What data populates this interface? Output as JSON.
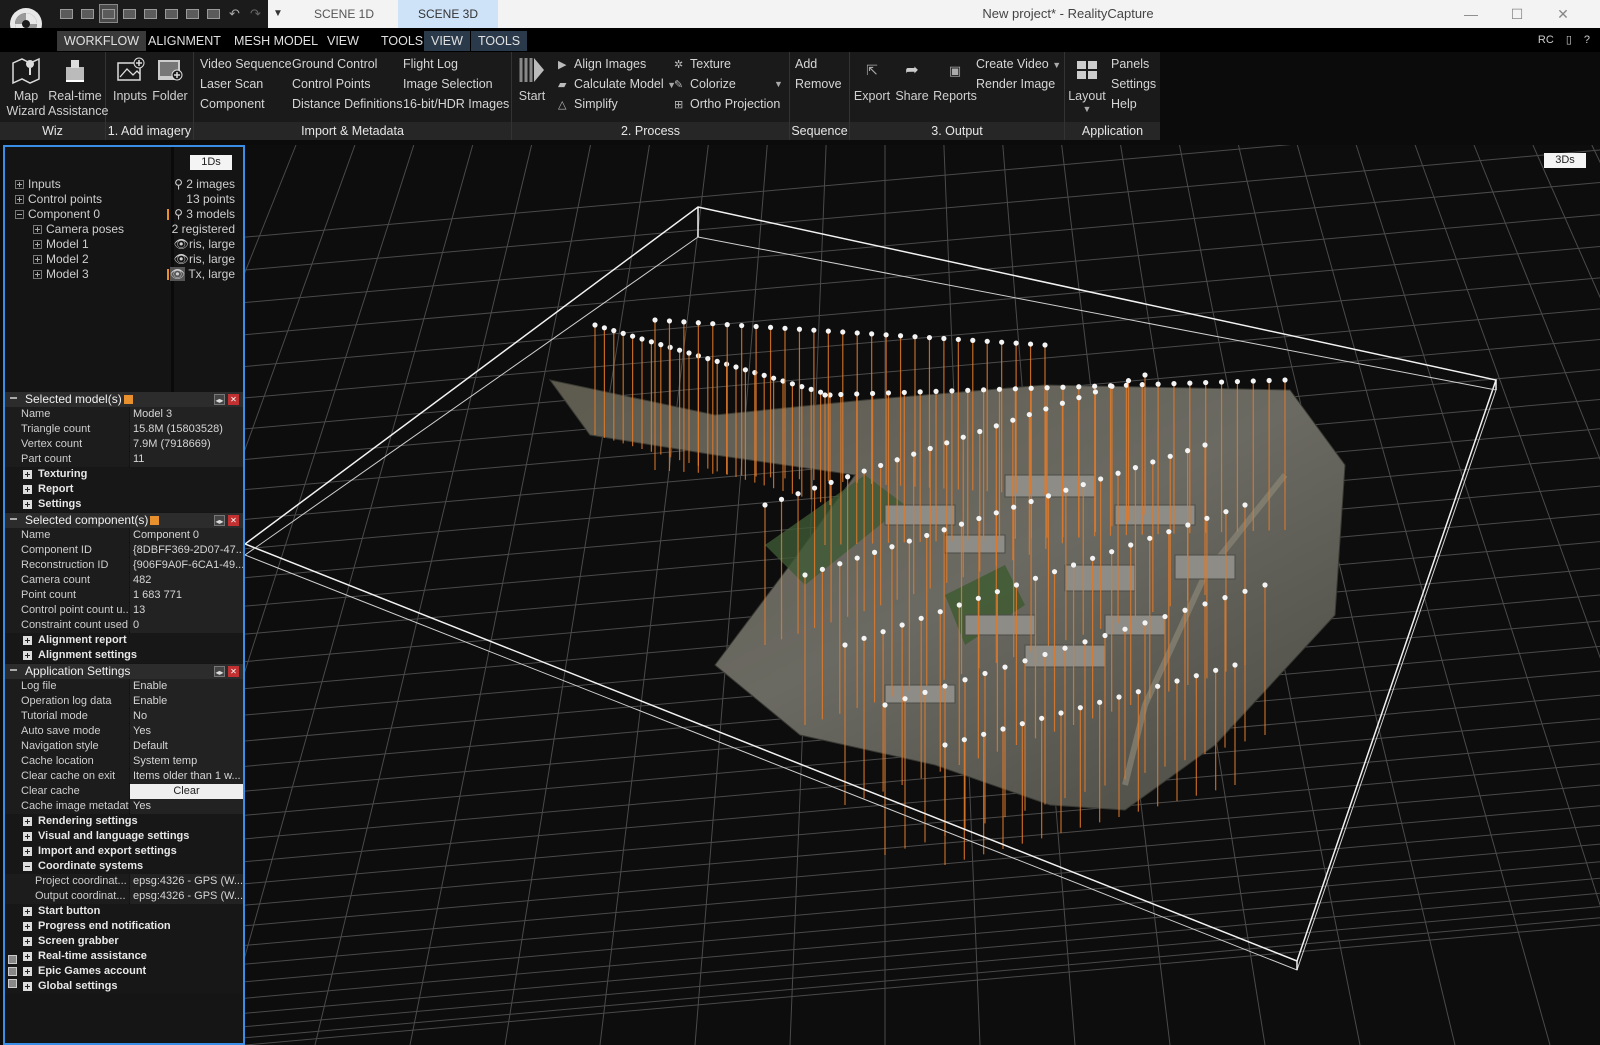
{
  "app": {
    "window_title": "New project* - RealityCapture",
    "scene_tabs": [
      "SCENE 1D",
      "SCENE 3D"
    ],
    "active_scene_tab": "SCENE 3D"
  },
  "menu": {
    "items": [
      "WORKFLOW",
      "ALIGNMENT",
      "MESH MODEL",
      "VIEW",
      "TOOLS",
      "VIEW",
      "TOOLS"
    ],
    "active": "WORKFLOW",
    "right": [
      "RC"
    ]
  },
  "ribbon": {
    "wiz": {
      "label": "Wiz",
      "map_wizard": "Map\nWizard",
      "realtime_assistance": "Real-time\nAssistance"
    },
    "add_imagery": {
      "label": "1. Add imagery",
      "inputs": "Inputs",
      "folder": "Folder"
    },
    "import": {
      "label": "Import & Metadata",
      "col1": [
        "Video Sequence",
        "Laser Scan",
        "Component"
      ],
      "col2": [
        "Ground Control",
        "Control Points",
        "Distance Definitions"
      ],
      "col3": [
        "Flight Log",
        "Image Selection",
        "16-bit/HDR Images"
      ]
    },
    "process": {
      "label": "2. Process",
      "start": "Start",
      "col1": [
        "Align Images",
        "Calculate Model",
        "Simplify"
      ],
      "col2": [
        "Texture",
        "Colorize",
        "Ortho Projection"
      ]
    },
    "sequence": {
      "label": "Sequence",
      "items": [
        "Add",
        "Remove"
      ]
    },
    "output": {
      "label": "3. Output",
      "export": "Export",
      "share": "Share",
      "reports": "Reports",
      "col": [
        "Create Video",
        "Render Image"
      ]
    },
    "application": {
      "label": "Application",
      "layout": "Layout",
      "col": [
        "Panels",
        "Settings",
        "Help"
      ]
    }
  },
  "tree": {
    "toggle": "1Ds",
    "rows": [
      {
        "label": "Inputs",
        "value": "2 images",
        "indent": 0
      },
      {
        "label": "Control points",
        "value": "13 points",
        "indent": 0
      },
      {
        "label": "Component 0",
        "value": "3 models",
        "indent": 0
      },
      {
        "label": "Camera poses",
        "value": "2 registered",
        "indent": 1
      },
      {
        "label": "Model 1",
        "value": "ris, large",
        "indent": 1
      },
      {
        "label": "Model 2",
        "value": "ris, large",
        "indent": 1
      },
      {
        "label": "Model 3",
        "value": "Tx, large",
        "indent": 1
      }
    ]
  },
  "selected_models": {
    "title": "Selected model(s)",
    "props": [
      [
        "Name",
        "Model 3"
      ],
      [
        "Triangle count",
        "15.8M (15803528)"
      ],
      [
        "Vertex count",
        "7.9M (7918669)"
      ],
      [
        "Part count",
        "11"
      ]
    ],
    "groups": [
      "Texturing",
      "Report",
      "Settings"
    ]
  },
  "selected_components": {
    "title": "Selected component(s)",
    "props": [
      [
        "Name",
        "Component 0"
      ],
      [
        "Component ID",
        "{8DBFF369-2D07-47..."
      ],
      [
        "Reconstruction ID",
        "{906F9A0F-6CA1-49..."
      ],
      [
        "Camera count",
        "482"
      ],
      [
        "Point count",
        "1 683 771"
      ],
      [
        "Control point count u...",
        "13"
      ],
      [
        "Constraint count used",
        "0"
      ]
    ],
    "groups": [
      "Alignment report",
      "Alignment settings"
    ]
  },
  "app_settings": {
    "title": "Application Settings",
    "props": [
      [
        "Log file",
        "Enable"
      ],
      [
        "Operation log data",
        "Enable"
      ],
      [
        "Tutorial mode",
        "No"
      ],
      [
        "Auto save mode",
        "Yes"
      ],
      [
        "Navigation style",
        "Default"
      ],
      [
        "Cache location",
        "System temp"
      ],
      [
        "Clear cache on exit",
        "Items older than 1 w..."
      ],
      [
        "Clear cache",
        "Clear"
      ],
      [
        "Cache image metadata",
        "Yes"
      ]
    ],
    "groups_a": [
      "Rendering settings",
      "Visual and language settings",
      "Import and export settings",
      "Coordinate systems"
    ],
    "coord_props": [
      [
        "Project coordinat...",
        "epsg:4326 - GPS (W..."
      ],
      [
        "Output coordinat...",
        "epsg:4326 - GPS (W..."
      ]
    ],
    "groups_b": [
      "Start button",
      "Progress end notification",
      "Screen grabber",
      "Real-time assistance",
      "Epic Games account",
      "Global settings"
    ]
  },
  "viewport": {
    "toggle": "3Ds",
    "colors": {
      "camera_line": "#e07a2a",
      "bbox": "#f2f2f2",
      "grid": "#4a4a4a",
      "panel_border": "#3a8ee6"
    }
  }
}
